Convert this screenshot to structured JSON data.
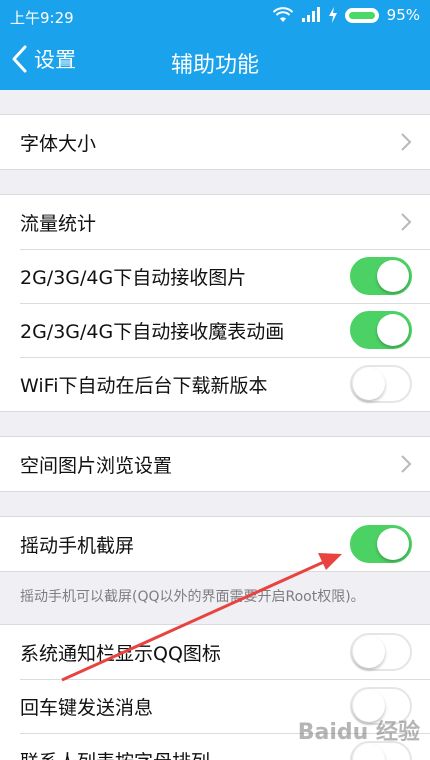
{
  "status_bar": {
    "time": "上午9:29",
    "battery": "95%"
  },
  "nav": {
    "back_label": "设置",
    "title": "辅助功能"
  },
  "groups": [
    {
      "rows": [
        {
          "label": "字体大小",
          "type": "chevron"
        }
      ]
    },
    {
      "rows": [
        {
          "label": "流量统计",
          "type": "chevron"
        },
        {
          "label": "2G/3G/4G下自动接收图片",
          "type": "toggle",
          "on": true
        },
        {
          "label": "2G/3G/4G下自动接收魔表动画",
          "type": "toggle",
          "on": true
        },
        {
          "label": "WiFi下自动在后台下载新版本",
          "type": "toggle",
          "on": false
        }
      ]
    },
    {
      "rows": [
        {
          "label": "空间图片浏览设置",
          "type": "chevron"
        }
      ]
    },
    {
      "rows": [
        {
          "label": "摇动手机截屏",
          "type": "toggle",
          "on": true
        }
      ],
      "note": "摇动手机可以截屏(QQ以外的界面需要开启Root权限)。"
    },
    {
      "rows": [
        {
          "label": "系统通知栏显示QQ图标",
          "type": "toggle",
          "on": false
        },
        {
          "label": "回车键发送消息",
          "type": "toggle",
          "on": false
        },
        {
          "label": "联系人列表按字母排列",
          "type": "toggle",
          "on": false
        }
      ]
    }
  ],
  "watermark": "Baidu 经验",
  "colors": {
    "header": "#1aa2ec",
    "toggle_on": "#4cd264",
    "arrow": "#e8433f"
  }
}
